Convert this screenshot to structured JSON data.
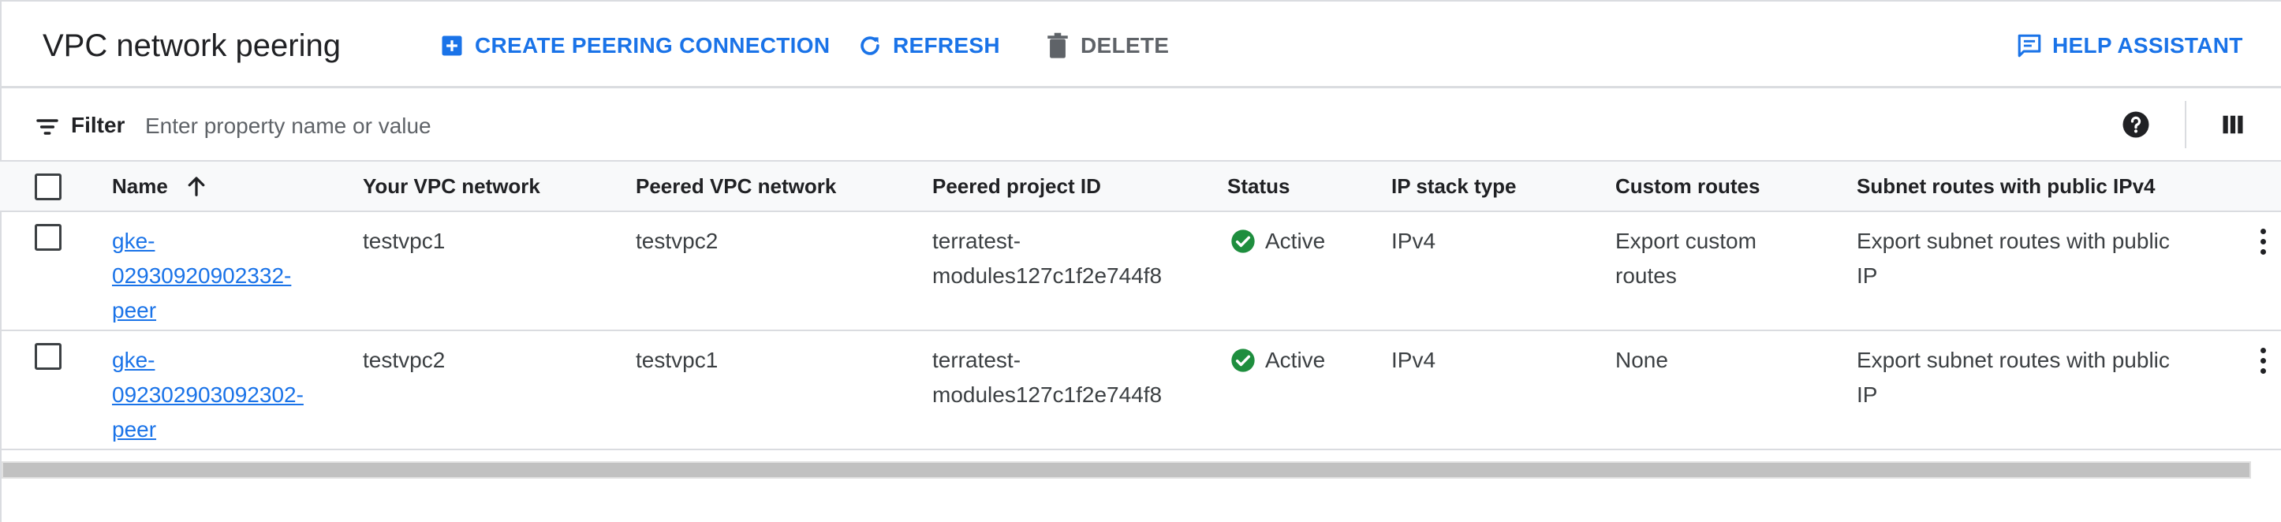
{
  "header": {
    "title": "VPC network peering",
    "create_label": "CREATE PEERING CONNECTION",
    "refresh_label": "REFRESH",
    "delete_label": "DELETE",
    "help_label": "HELP ASSISTANT"
  },
  "filter": {
    "label": "Filter",
    "placeholder": "Enter property name or value"
  },
  "table": {
    "columns": [
      "Name",
      "Your VPC network",
      "Peered VPC network",
      "Peered project ID",
      "Status",
      "IP stack type",
      "Custom routes",
      "Subnet routes with public IPv4"
    ],
    "sort": {
      "column": "Name",
      "direction": "ascending",
      "icon": "arrow-up-icon"
    },
    "rows": [
      {
        "name_lines": [
          "gke-",
          "02930920902332-",
          "peer"
        ],
        "your_vpc": "testvpc1",
        "peered_vpc": "testvpc2",
        "project_lines": [
          "terratest-",
          "modules127c1f2e744f8"
        ],
        "status": "Active",
        "ip_stack": "IPv4",
        "custom_routes_lines": [
          "Export custom",
          "routes"
        ],
        "subnet_routes_lines": [
          "Export subnet routes with public",
          "IP"
        ]
      },
      {
        "name_lines": [
          "gke-",
          "092302903092302-",
          "peer"
        ],
        "your_vpc": "testvpc2",
        "peered_vpc": "testvpc1",
        "project_lines": [
          "terratest-",
          "modules127c1f2e744f8"
        ],
        "status": "Active",
        "ip_stack": "IPv4",
        "custom_routes_lines": [
          "None"
        ],
        "subnet_routes_lines": [
          "Export subnet routes with public",
          "IP"
        ]
      }
    ]
  },
  "colors": {
    "accent": "#1a73e8",
    "status_active": "#1e8e3e",
    "text": "#202124",
    "muted": "#5f6368",
    "divider": "#dadce0"
  }
}
